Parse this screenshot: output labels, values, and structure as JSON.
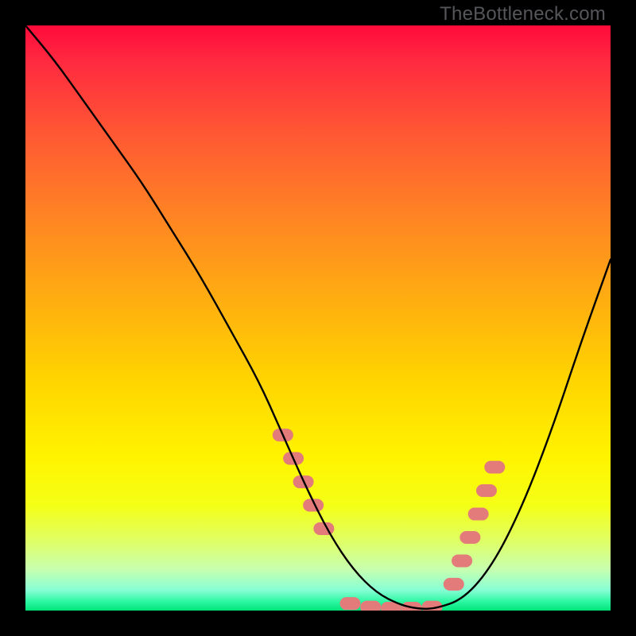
{
  "watermark": "TheBottleneck.com",
  "chart_data": {
    "type": "line",
    "title": "",
    "xlabel": "",
    "ylabel": "",
    "xlim": [
      0,
      100
    ],
    "ylim": [
      0,
      100
    ],
    "grid": false,
    "legend": false,
    "series": [
      {
        "name": "bottleneck-curve",
        "color": "#000000",
        "x": [
          0,
          5,
          10,
          15,
          20,
          25,
          30,
          35,
          40,
          44,
          48,
          52,
          56,
          60,
          64,
          67,
          70,
          75,
          80,
          85,
          90,
          95,
          100
        ],
        "y": [
          100,
          94,
          87,
          80,
          73,
          65,
          57,
          48,
          39,
          30,
          21,
          13,
          7,
          3,
          1,
          0.3,
          0.3,
          2,
          8,
          18,
          31,
          46,
          60
        ]
      }
    ],
    "markers": [
      {
        "name": "highlight-dots",
        "color": "#e47b7b",
        "shape": "rounded-pill",
        "points": [
          {
            "x": 44.0,
            "y": 30.0
          },
          {
            "x": 45.8,
            "y": 26.0
          },
          {
            "x": 47.5,
            "y": 22.0
          },
          {
            "x": 49.2,
            "y": 18.0
          },
          {
            "x": 51.0,
            "y": 14.0
          },
          {
            "x": 55.5,
            "y": 1.2
          },
          {
            "x": 59.0,
            "y": 0.6
          },
          {
            "x": 62.5,
            "y": 0.4
          },
          {
            "x": 66.0,
            "y": 0.4
          },
          {
            "x": 69.5,
            "y": 0.6
          },
          {
            "x": 73.2,
            "y": 4.5
          },
          {
            "x": 74.6,
            "y": 8.5
          },
          {
            "x": 76.0,
            "y": 12.5
          },
          {
            "x": 77.4,
            "y": 16.5
          },
          {
            "x": 78.8,
            "y": 20.5
          },
          {
            "x": 80.2,
            "y": 24.5
          }
        ]
      }
    ]
  }
}
